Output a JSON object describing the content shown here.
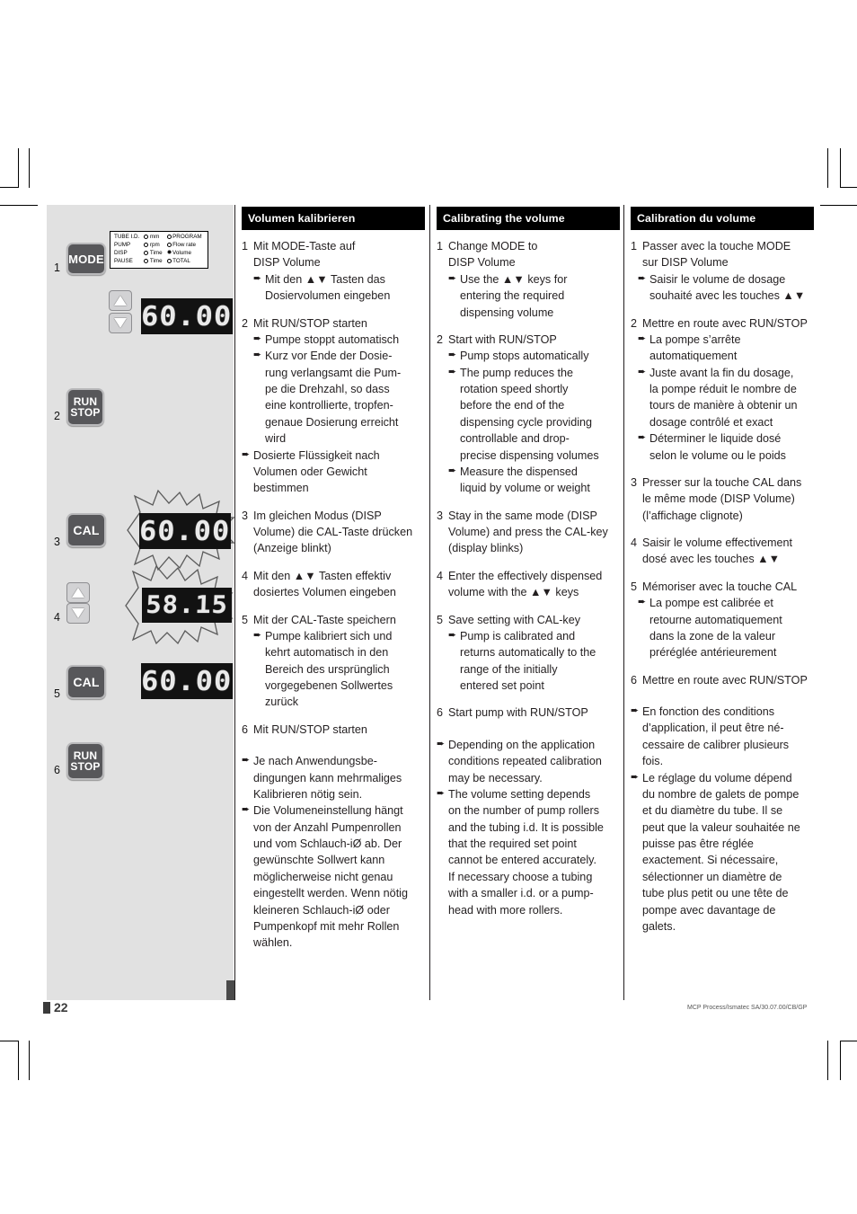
{
  "document": {
    "page_number": "22",
    "doc_code": "MCP Process/Ismatec SA/30.07.00/CB/GP"
  },
  "illustration": {
    "steps": [
      "1",
      "2",
      "3",
      "4",
      "5",
      "6"
    ],
    "keys": {
      "mode": "MODE",
      "run": "RUN",
      "stop": "STOP",
      "cal": "CAL"
    },
    "mode_legend": {
      "rows": [
        {
          "c1": "TUBE I.D.",
          "c2": "mm",
          "c2_marker": "dot",
          "c3": "PROGRAM",
          "c3_marker": "dot"
        },
        {
          "c1": "PUMP",
          "c2": "rpm",
          "c2_marker": "dot",
          "c3": "Flow rate",
          "c3_marker": "dot"
        },
        {
          "c1": "DISP",
          "c2": "Time",
          "c2_marker": "dot",
          "c3": "Volume",
          "c3_marker": "star"
        },
        {
          "c1": "PAUSE",
          "c2": "Time",
          "c2_marker": "dot",
          "c3": "TOTAL",
          "c3_marker": "dot"
        }
      ]
    },
    "displays": {
      "step1": "60.00",
      "step3": "60.00",
      "step4": "58.15",
      "step5": "60.00"
    }
  },
  "columns": {
    "de": {
      "heading": "Volumen kalibrieren",
      "blocks": [
        {
          "num": "1",
          "lines": [
            "Mit MODE-Taste auf",
            "DISP Volume"
          ],
          "subs": [
            {
              "lines": [
                "Mit den ▲▼ Tasten das",
                "Dosiervolumen eingeben"
              ]
            }
          ]
        },
        {
          "num": "2",
          "lines": [
            "Mit RUN/STOP starten"
          ],
          "subs": [
            {
              "lines": [
                "Pumpe stoppt automatisch"
              ]
            },
            {
              "lines": [
                "Kurz vor Ende der Dosie-",
                "rung verlangsamt die Pum-",
                "pe die Drehzahl, so dass",
                "eine kontrollierte, tropfen-",
                "genaue Dosierung erreicht",
                "wird"
              ]
            },
            {
              "lines": [
                "Dosierte Flüssigkeit nach",
                "Volumen oder Gewicht",
                "bestimmen"
              ],
              "hang": "flush"
            }
          ]
        },
        {
          "num": "3",
          "lines": [
            "Im gleichen Modus (DISP",
            "Volume) die CAL-Taste drücken",
            "(Anzeige blinkt)"
          ],
          "subs": []
        },
        {
          "num": "4",
          "lines": [
            "Mit den ▲▼ Tasten effektiv",
            "dosiertes Volumen eingeben"
          ],
          "subs": []
        },
        {
          "num": "5",
          "lines": [
            "Mit der CAL-Taste speichern"
          ],
          "subs": [
            {
              "lines": [
                "Pumpe kalibriert sich und",
                "kehrt automatisch in den",
                "Bereich des ursprünglich",
                "vorgegebenen Sollwertes",
                "zurück"
              ]
            }
          ]
        },
        {
          "num": "6",
          "lines": [
            "Mit RUN/STOP starten"
          ],
          "subs": []
        }
      ],
      "notes": [
        {
          "lines": [
            "Je nach Anwendungsbe-",
            "dingungen kann mehrmaliges",
            "Kalibrieren nötig sein."
          ]
        },
        {
          "lines": [
            "Die Volumeneinstellung hängt",
            "von der Anzahl Pumpenrollen",
            "und vom Schlauch-iØ ab. Der",
            "gewünschte Sollwert kann",
            "möglicherweise nicht genau",
            "eingestellt werden. Wenn nötig",
            "kleineren Schlauch-iØ oder",
            "Pumpenkopf mit mehr Rollen",
            "wählen."
          ]
        }
      ]
    },
    "en": {
      "heading": "Calibrating the volume",
      "blocks": [
        {
          "num": "1",
          "lines": [
            "Change MODE to",
            "DISP Volume"
          ],
          "subs": [
            {
              "lines": [
                "Use the ▲▼ keys for",
                "entering the required",
                "dispensing volume"
              ]
            }
          ]
        },
        {
          "num": "2",
          "lines": [
            "Start with RUN/STOP"
          ],
          "subs": [
            {
              "lines": [
                "Pump stops automatically"
              ]
            },
            {
              "lines": [
                "The pump reduces the",
                "rotation speed shortly",
                "before the end of the",
                "dispensing cycle providing",
                "controllable and drop-",
                "precise dispensing volumes"
              ]
            },
            {
              "lines": [
                "Measure the dispensed",
                "liquid by volume or weight"
              ]
            }
          ]
        },
        {
          "num": "3",
          "lines": [
            "Stay in the same mode (DISP",
            "Volume) and press the CAL-key",
            "(display blinks)"
          ],
          "subs": []
        },
        {
          "num": "4",
          "lines": [
            "Enter the effectively dispensed",
            "volume with the ▲▼ keys"
          ],
          "subs": []
        },
        {
          "num": "5",
          "lines": [
            "Save setting with CAL-key"
          ],
          "subs": [
            {
              "lines": [
                "Pump is calibrated and",
                "returns automatically to the",
                "range of the initially",
                "entered set point"
              ]
            }
          ]
        },
        {
          "num": "6",
          "lines": [
            "Start pump with RUN/STOP"
          ],
          "subs": []
        }
      ],
      "notes": [
        {
          "lines": [
            "Depending on the application",
            "conditions repeated calibration",
            "may be necessary."
          ]
        },
        {
          "lines": [
            "The volume setting depends",
            "on the number of pump rollers",
            "and the tubing i.d. It is possible",
            "that the required set point",
            "cannot be entered accurately.",
            "If necessary choose a tubing",
            "with a smaller i.d. or a pump-",
            "head with more rollers."
          ]
        }
      ]
    },
    "fr": {
      "heading": "Calibration du volume",
      "blocks": [
        {
          "num": "1",
          "lines": [
            "Passer avec la touche MODE",
            "sur DISP Volume"
          ],
          "subs": [
            {
              "lines": [
                "Saisir le volume de dosage",
                "souhaité avec les touches ▲▼"
              ],
              "hang": "flush2"
            }
          ]
        },
        {
          "num": "2",
          "lines": [
            "Mettre en route avec RUN/STOP"
          ],
          "subs": [
            {
              "lines": [
                "La pompe s’arrête",
                "automatiquement"
              ],
              "hang": "flush2"
            },
            {
              "lines": [
                "Juste avant la fin du dosage,",
                "la pompe réduit le nombre de",
                "tours de manière à obtenir un",
                "dosage contrôlé et exact"
              ],
              "hang": "flush2"
            },
            {
              "lines": [
                "Déterminer le liquide dosé",
                "selon le volume ou le poids"
              ],
              "hang": "flush2"
            }
          ]
        },
        {
          "num": "3",
          "lines": [
            "Presser sur la touche CAL dans",
            "le même mode (DISP Volume)",
            "(l’affichage clignote)"
          ],
          "subs": []
        },
        {
          "num": "4",
          "lines": [
            "Saisir le volume effectivement",
            "dosé avec les touches ▲▼"
          ],
          "subs": []
        },
        {
          "num": "5",
          "lines": [
            "Mémoriser avec la touche CAL"
          ],
          "subs": [
            {
              "lines": [
                "La pompe est calibrée et",
                "retourne automatiquement",
                "dans la zone de la valeur",
                "préréglée antérieurement"
              ],
              "hang": "flush2"
            }
          ]
        },
        {
          "num": "6",
          "lines": [
            "Mettre en route avec RUN/STOP"
          ],
          "subs": []
        }
      ],
      "notes": [
        {
          "lines": [
            "En fonction des conditions",
            "d’application, il peut être né-",
            "cessaire de calibrer plusieurs",
            "fois."
          ]
        },
        {
          "lines": [
            "Le réglage du volume dépend",
            "du nombre de galets de pompe",
            "et du diamètre du tube. Il se",
            "peut que la valeur souhaitée ne",
            "puisse pas être réglée",
            "exactement. Si nécessaire,",
            "sélectionner un diamètre de",
            "tube plus petit ou une tête de",
            "pompe avec davantage de",
            "galets."
          ]
        }
      ]
    }
  }
}
